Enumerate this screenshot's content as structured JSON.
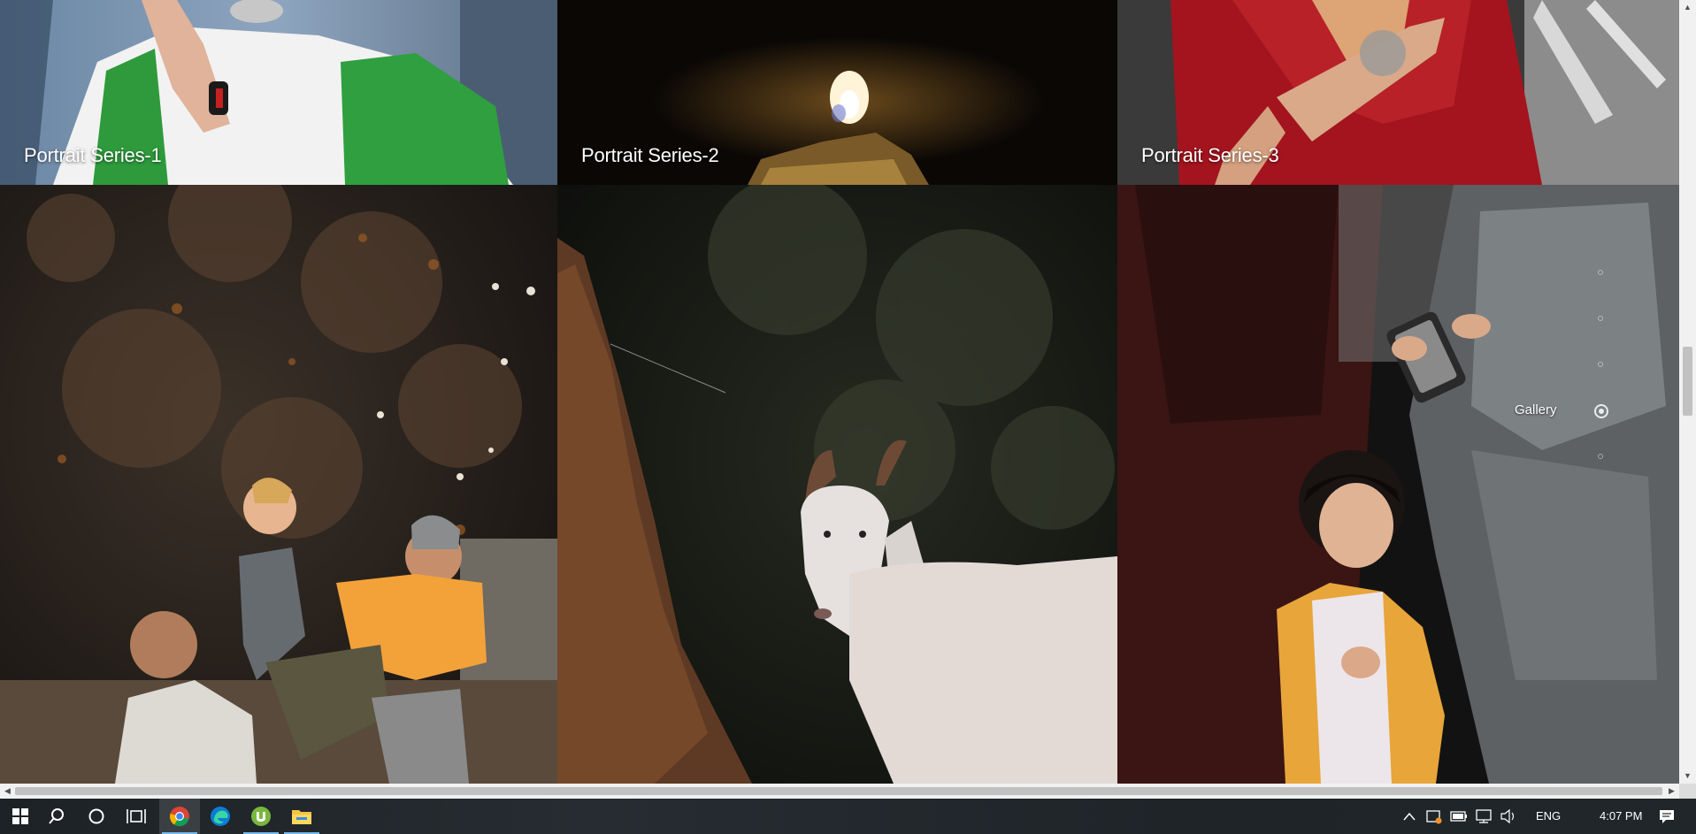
{
  "gallery": {
    "tiles": [
      {
        "caption": "Portrait Series-1"
      },
      {
        "caption": "Portrait Series-2"
      },
      {
        "caption": "Portrait Series-3"
      }
    ]
  },
  "dotnav": {
    "active_label": "Gallery",
    "dot_count": 5,
    "active_index": 3
  },
  "taskbar": {
    "items": [
      "start-icon",
      "search-icon",
      "cortana-icon",
      "task-view-icon",
      "chrome-icon",
      "edge-icon",
      "utorrent-icon",
      "file-explorer-icon"
    ],
    "language": "ENG",
    "time": "4:07 PM"
  },
  "colors": {
    "taskbar_bg": "#20262a",
    "active_underline": "#76b9ed",
    "scrollbar_track": "#f1f1f1",
    "scrollbar_thumb": "#c1c1c1"
  }
}
